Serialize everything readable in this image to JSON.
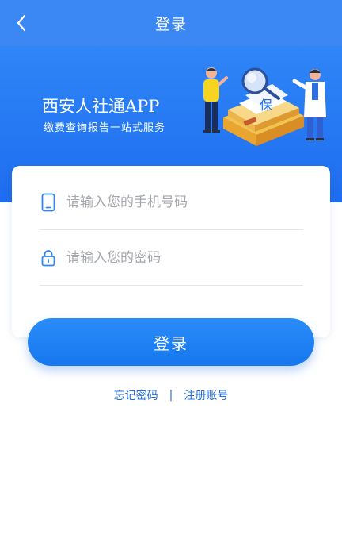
{
  "nav": {
    "title": "登录"
  },
  "hero": {
    "title": "西安人社通APP",
    "subtitle": "缴费查询报告一站式服务",
    "badge_char": "保"
  },
  "form": {
    "phone_placeholder": "请输入您的手机号码",
    "password_placeholder": "请输入您的密码"
  },
  "actions": {
    "login_label": "登录",
    "forgot_label": "忘记密码",
    "separator": "|",
    "register_label": "注册账号"
  },
  "colors": {
    "primary": "#1e6cf0",
    "nav": "#3b87f4",
    "link": "#1f6fe0",
    "placeholder": "#a3a6ab"
  }
}
